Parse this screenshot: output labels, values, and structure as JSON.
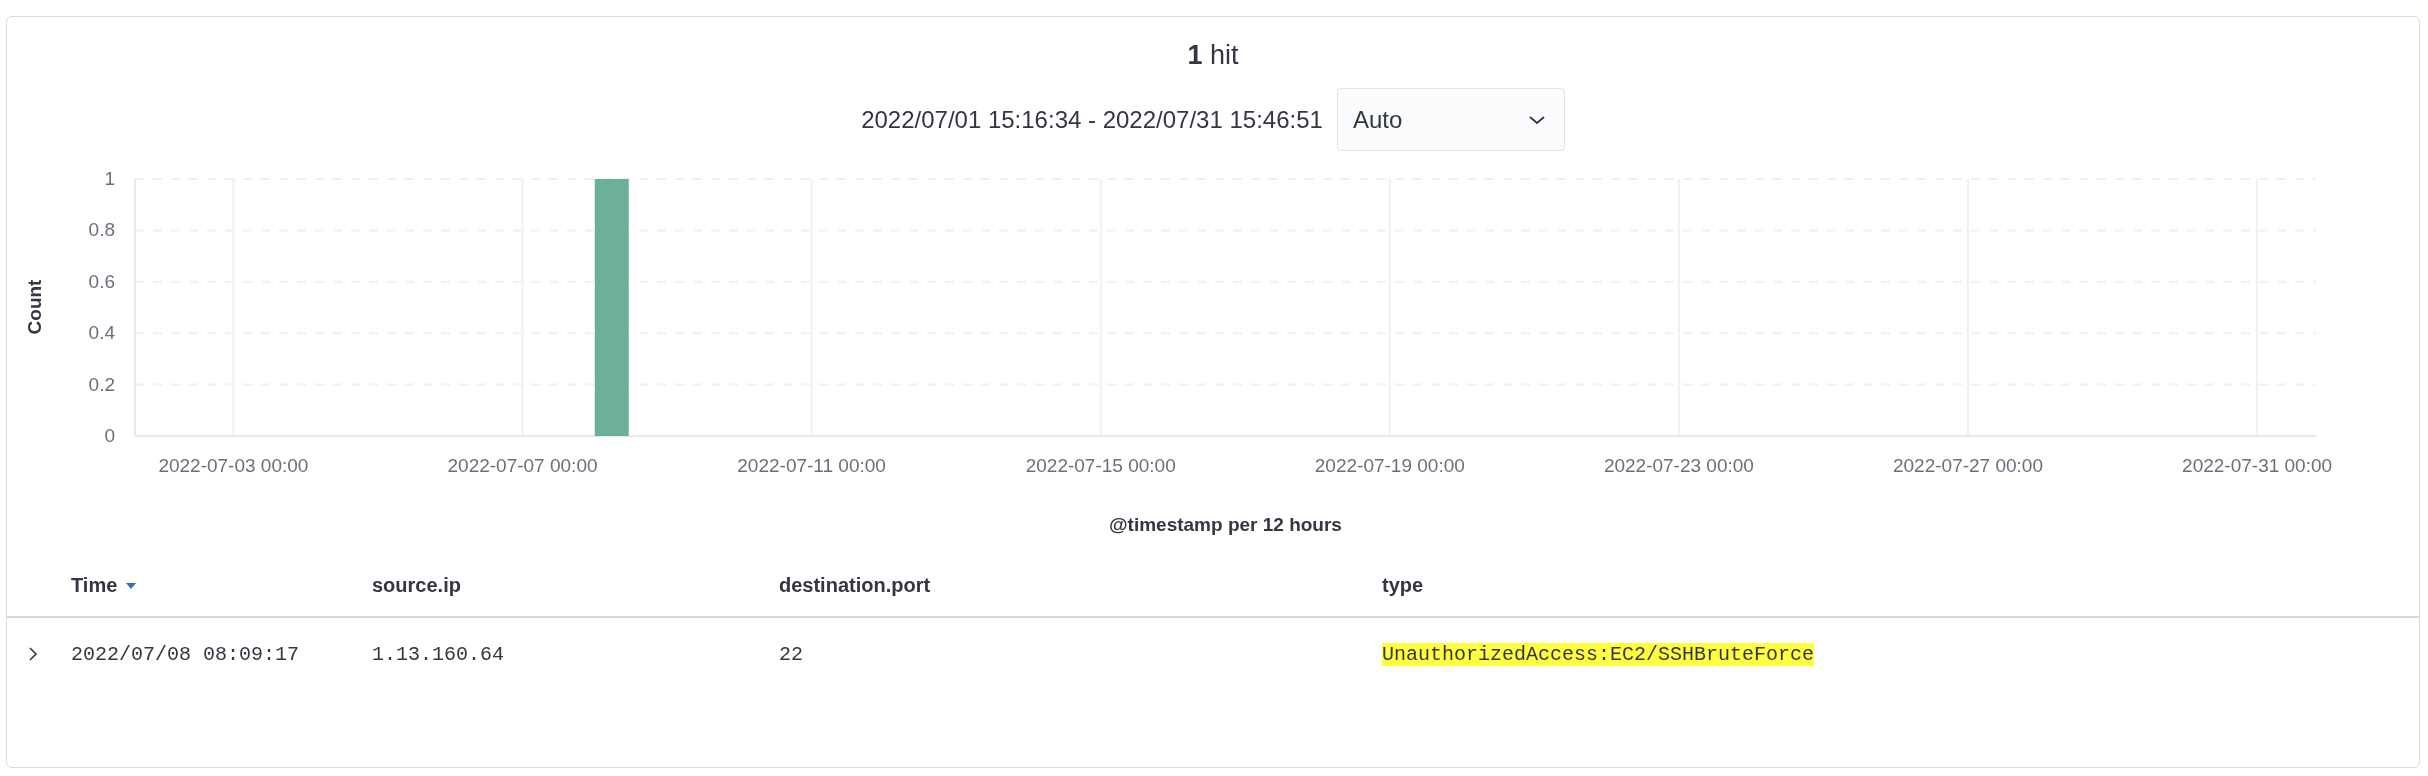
{
  "summary": {
    "count": "1",
    "label": "hit"
  },
  "time_range": {
    "text": "2022/07/01 15:16:34 - 2022/07/31 15:46:51",
    "interval": "Auto"
  },
  "histogram": {
    "chart_data": {
      "type": "bar",
      "grid": true,
      "xlabel": "@timestamp per 12 hours",
      "ylabel": "Count",
      "categories": [
        null,
        null,
        null,
        "2022-07-03 00:00",
        null,
        null,
        null,
        null,
        null,
        null,
        null,
        "2022-07-07 00:00",
        null,
        null,
        null,
        null,
        null,
        null,
        null,
        "2022-07-11 00:00",
        null,
        null,
        null,
        null,
        null,
        null,
        null,
        "2022-07-15 00:00",
        null,
        null,
        null,
        null,
        null,
        null,
        null,
        "2022-07-19 00:00",
        null,
        null,
        null,
        null,
        null,
        null,
        null,
        "2022-07-23 00:00",
        null,
        null,
        null,
        null,
        null,
        null,
        null,
        "2022-07-27 00:00",
        null,
        null,
        null,
        null,
        null,
        null,
        null,
        "2022-07-31 00:00",
        null
      ],
      "series": [
        {
          "color": "#6db09a",
          "values": [
            0,
            0,
            0,
            0,
            0,
            0,
            0,
            0,
            0,
            0,
            0,
            0,
            0,
            1,
            0,
            0,
            0,
            0,
            0,
            0,
            0,
            0,
            0,
            0,
            0,
            0,
            0,
            0,
            0,
            0,
            0,
            0,
            0,
            0,
            0,
            0,
            0,
            0,
            0,
            0,
            0,
            0,
            0,
            0,
            0,
            0,
            0,
            0,
            0,
            0,
            0,
            0,
            0,
            0,
            0,
            0,
            0,
            0,
            0,
            0,
            0
          ]
        }
      ],
      "ylim": [
        0,
        1
      ],
      "yticks": [
        0,
        0.2,
        0.4,
        0.6,
        0.8,
        1
      ]
    }
  },
  "table": {
    "columns": [
      {
        "label": "Time",
        "sorted": true
      },
      {
        "label": "source.ip",
        "sorted": false
      },
      {
        "label": "destination.port",
        "sorted": false
      },
      {
        "label": "type",
        "sorted": false
      }
    ],
    "rows": [
      {
        "expanded": false,
        "cells": [
          {
            "text": "2022/07/08 08:09:17",
            "highlighted": false
          },
          {
            "text": "1.13.160.64",
            "highlighted": false
          },
          {
            "text": "22",
            "highlighted": false
          },
          {
            "text": "UnauthorizedAccess:EC2/SSHBruteForce",
            "highlighted": true
          }
        ]
      }
    ]
  }
}
